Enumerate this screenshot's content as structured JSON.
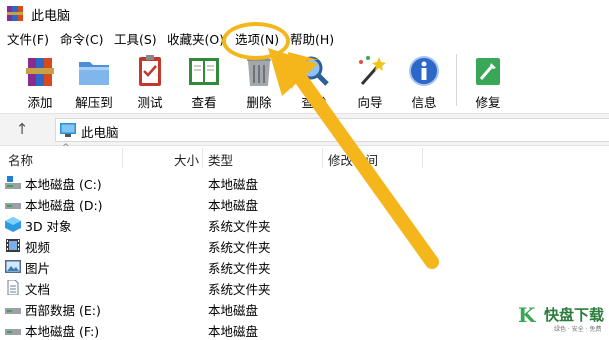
{
  "window": {
    "title": "此电脑"
  },
  "menu": [
    {
      "label": "文件(F)"
    },
    {
      "label": "命令(C)"
    },
    {
      "label": "工具(S)"
    },
    {
      "label": "收藏夹(O)"
    },
    {
      "label": "选项(N)"
    },
    {
      "label": "帮助(H)"
    }
  ],
  "toolbar": [
    {
      "label": "添加",
      "icon": "add-archive-icon"
    },
    {
      "label": "解压到",
      "icon": "extract-folder-icon"
    },
    {
      "label": "测试",
      "icon": "test-clipboard-icon"
    },
    {
      "label": "查看",
      "icon": "view-book-icon"
    },
    {
      "label": "删除",
      "icon": "trash-can-icon"
    },
    {
      "label": "查找",
      "icon": "magnifier-icon"
    },
    {
      "label": "向导",
      "icon": "wizard-wand-icon"
    },
    {
      "label": "信息",
      "icon": "info-icon"
    },
    {
      "label": "修复",
      "icon": "repair-kit-icon"
    }
  ],
  "address": {
    "path": "此电脑"
  },
  "columns": {
    "name": "名称",
    "size": "大小",
    "type": "类型",
    "modified": "修改时间"
  },
  "rows": [
    {
      "name": "本地磁盘 (C:)",
      "type": "本地磁盘",
      "icon": "system-drive-icon"
    },
    {
      "name": "本地磁盘 (D:)",
      "type": "本地磁盘",
      "icon": "drive-icon"
    },
    {
      "name": "3D 对象",
      "type": "系统文件夹",
      "icon": "3d-objects-icon"
    },
    {
      "name": "视频",
      "type": "系统文件夹",
      "icon": "video-folder-icon"
    },
    {
      "name": "图片",
      "type": "系统文件夹",
      "icon": "pictures-folder-icon"
    },
    {
      "name": "文档",
      "type": "系统文件夹",
      "icon": "documents-folder-icon"
    },
    {
      "name": "西部数据 (E:)",
      "type": "本地磁盘",
      "icon": "drive-icon"
    },
    {
      "name": "本地磁盘 (F:)",
      "type": "本地磁盘",
      "icon": "drive-icon"
    }
  ],
  "watermark": {
    "brand": "快盘下载",
    "tagline": "绿色 · 安全 · 免费"
  },
  "colors": {
    "highlight": "#f5b61c"
  }
}
